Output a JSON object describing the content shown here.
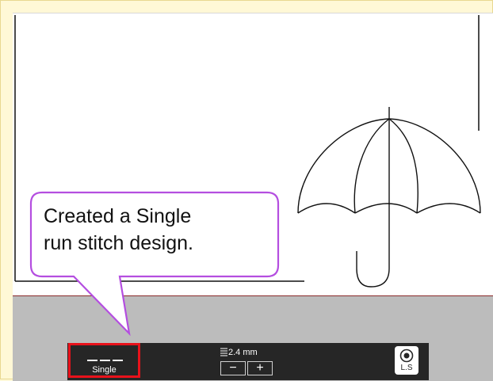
{
  "callout": {
    "text_line1": "Created a Single",
    "text_line2": "run stitch design."
  },
  "toolbar": {
    "stitch_type_label": "Single",
    "stitch_length_value": "2.4 mm",
    "minus_label": "−",
    "plus_label": "+",
    "ls_label": "L.S"
  },
  "colors": {
    "highlight": "#e8121b",
    "callout_border": "#b44ee0",
    "toolbar_bg": "#262626",
    "page_bg": "#fff8d6"
  },
  "icons": {
    "stitch_type": "single-run-stitch-icon",
    "length": "stitch-length-icon",
    "ls": "ls-bobbin-icon"
  }
}
